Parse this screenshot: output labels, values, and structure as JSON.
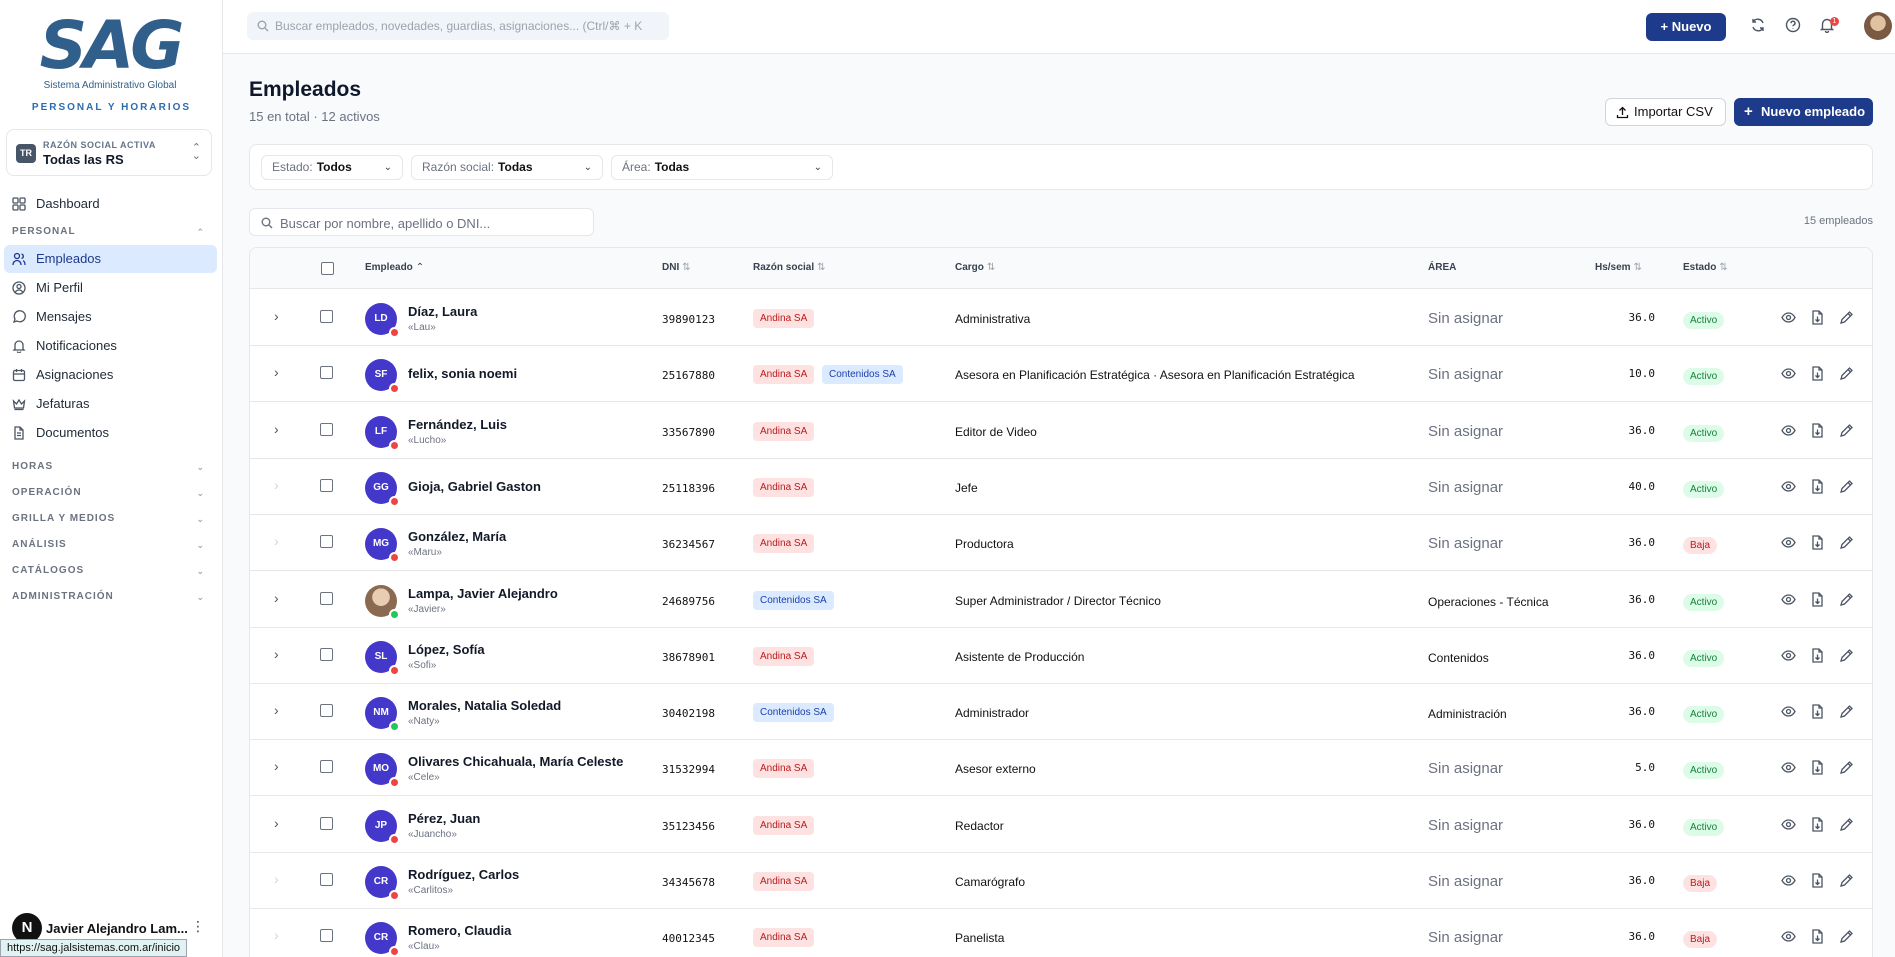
{
  "sidebar": {
    "logo_mark": "SAG",
    "logo_sub": "Sistema Administrativo Global",
    "tagline": "PERSONAL Y HORARIOS",
    "rs": {
      "badge": "TR",
      "label": "RAZÓN SOCIAL ACTIVA",
      "value": "Todas las RS"
    },
    "dashboard": "Dashboard",
    "section_personal": "PERSONAL",
    "items": [
      "Empleados",
      "Mi Perfil",
      "Mensajes",
      "Notificaciones",
      "Asignaciones",
      "Jefaturas",
      "Documentos"
    ],
    "sections": [
      "HORAS",
      "OPERACIÓN",
      "GRILLA Y MEDIOS",
      "ANÁLISIS",
      "CATÁLOGOS",
      "ADMINISTRACIÓN"
    ],
    "user": {
      "initial": "N",
      "name": "Javier Alejandro Lam..."
    },
    "url": "https://sag.jalsistemas.com.ar/inicio"
  },
  "topbar": {
    "search_placeholder": "Buscar empleados, novedades, guardias, asignaciones... (Ctrl/⌘ + K",
    "new_label": "+ Nuevo",
    "notif_count": "1"
  },
  "page": {
    "title": "Empleados",
    "subtitle": "15 en total · 12 activos",
    "import_label": "Importar CSV",
    "new_employee_label": "Nuevo empleado"
  },
  "filters": {
    "estado": {
      "label": "Estado:",
      "value": "Todos"
    },
    "razon": {
      "label": "Razón social:",
      "value": "Todas"
    },
    "area": {
      "label": "Área:",
      "value": "Todas"
    }
  },
  "list": {
    "search_placeholder": "Buscar por nombre, apellido o DNI...",
    "count": "15 empleados"
  },
  "table": {
    "headers": {
      "empleado": "Empleado",
      "dni": "DNI",
      "razon": "Razón social",
      "cargo": "Cargo",
      "area": "ÁREA",
      "hs": "Hs/sem",
      "estado": "Estado"
    },
    "rows": [
      {
        "initials": "LD",
        "name": "Díaz, Laura",
        "nick": "«Lau»",
        "dni": "39890123",
        "tags": [
          "Andina SA"
        ],
        "cargo": "Administrativa",
        "area": "Sin asignar",
        "hs": "36.0",
        "estado": "Activo",
        "dot": "#ef4444",
        "expandable": true
      },
      {
        "initials": "SF",
        "name": "felix, sonia noemi",
        "nick": "",
        "dni": "25167880",
        "tags": [
          "Andina SA",
          "Contenidos SA"
        ],
        "cargo": "Asesora en Planificación Estratégica · Asesora en Planificación Estratégica",
        "area": "Sin asignar",
        "hs": "10.0",
        "estado": "Activo",
        "dot": "#ef4444",
        "expandable": true
      },
      {
        "initials": "LF",
        "name": "Fernández, Luis",
        "nick": "«Lucho»",
        "dni": "33567890",
        "tags": [
          "Andina SA"
        ],
        "cargo": "Editor de Video",
        "area": "Sin asignar",
        "hs": "36.0",
        "estado": "Activo",
        "dot": "#ef4444",
        "expandable": true
      },
      {
        "initials": "GG",
        "name": "Gioja, Gabriel Gaston",
        "nick": "",
        "dni": "25118396",
        "tags": [
          "Andina SA"
        ],
        "cargo": "Jefe",
        "area": "Sin asignar",
        "hs": "40.0",
        "estado": "Activo",
        "dot": "#ef4444",
        "expandable": false
      },
      {
        "initials": "MG",
        "name": "González, María",
        "nick": "«Maru»",
        "dni": "36234567",
        "tags": [
          "Andina SA"
        ],
        "cargo": "Productora",
        "area": "Sin asignar",
        "hs": "36.0",
        "estado": "Baja",
        "dot": "#ef4444",
        "expandable": false
      },
      {
        "initials": "",
        "photo": true,
        "name": "Lampa, Javier Alejandro",
        "nick": "«Javier»",
        "dni": "24689756",
        "tags": [
          "Contenidos SA"
        ],
        "cargo": "Super Administrador / Director Técnico",
        "area": "Operaciones - Técnica",
        "hs": "36.0",
        "estado": "Activo",
        "dot": "#22c55e",
        "expandable": true
      },
      {
        "initials": "SL",
        "name": "López, Sofía",
        "nick": "«Sofi»",
        "dni": "38678901",
        "tags": [
          "Andina SA"
        ],
        "cargo": "Asistente de Producción",
        "area": "Contenidos",
        "hs": "36.0",
        "estado": "Activo",
        "dot": "#ef4444",
        "expandable": true
      },
      {
        "initials": "NM",
        "name": "Morales, Natalia Soledad",
        "nick": "«Naty»",
        "dni": "30402198",
        "tags": [
          "Contenidos SA"
        ],
        "cargo": "Administrador",
        "area": "Administración",
        "hs": "36.0",
        "estado": "Activo",
        "dot": "#22c55e",
        "expandable": true
      },
      {
        "initials": "MO",
        "name": "Olivares Chicahuala, María Celeste",
        "nick": "«Cele»",
        "dni": "31532994",
        "tags": [
          "Andina SA"
        ],
        "cargo": "Asesor externo",
        "area": "Sin asignar",
        "hs": "5.0",
        "estado": "Activo",
        "dot": "#ef4444",
        "expandable": true
      },
      {
        "initials": "JP",
        "name": "Pérez, Juan",
        "nick": "«Juancho»",
        "dni": "35123456",
        "tags": [
          "Andina SA"
        ],
        "cargo": "Redactor",
        "area": "Sin asignar",
        "hs": "36.0",
        "estado": "Activo",
        "dot": "#ef4444",
        "expandable": true
      },
      {
        "initials": "CR",
        "name": "Rodríguez, Carlos",
        "nick": "«Carlitos»",
        "dni": "34345678",
        "tags": [
          "Andina SA"
        ],
        "cargo": "Camarógrafo",
        "area": "Sin asignar",
        "hs": "36.0",
        "estado": "Baja",
        "dot": "#ef4444",
        "expandable": false
      },
      {
        "initials": "CR",
        "name": "Romero, Claudia",
        "nick": "«Clau»",
        "dni": "40012345",
        "tags": [
          "Andina SA"
        ],
        "cargo": "Panelista",
        "area": "Sin asignar",
        "hs": "36.0",
        "estado": "Baja",
        "dot": "#ef4444",
        "expandable": false
      }
    ]
  },
  "icons": {
    "expand": "chevron-right-icon",
    "view": "eye-icon",
    "document": "document-icon",
    "edit": "pencil-icon"
  }
}
